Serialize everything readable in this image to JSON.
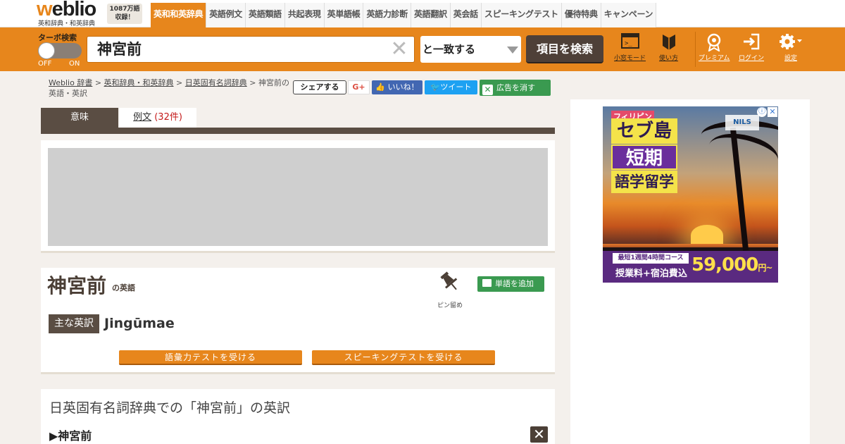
{
  "header": {
    "logo": "weblio",
    "logo_sub": "英和辞典・和英辞典",
    "count_line1": "1087万語",
    "count_line2": "収録！",
    "nav_tabs": [
      {
        "label": "英和和英辞典",
        "active": true
      },
      {
        "label": "英語例文"
      },
      {
        "label": "英語類語"
      },
      {
        "label": "共起表現"
      },
      {
        "label": "英単語帳"
      },
      {
        "label": "英語力診断"
      },
      {
        "label": "英語翻訳"
      },
      {
        "label": "英会話"
      },
      {
        "label": "スピーキングテスト"
      },
      {
        "label": "優待特典"
      },
      {
        "label": "キャンペーン"
      }
    ]
  },
  "search": {
    "turbo_label": "ターボ検索",
    "toggle_off": "OFF",
    "toggle_on": "ON",
    "query": "神宮前",
    "match_mode": "と一致する",
    "submit_label": "項目を検索",
    "icons": [
      {
        "name": "small-window-mode-icon",
        "label": "小窓モード"
      },
      {
        "name": "beginner-guide-icon",
        "label": "使い方"
      },
      {
        "name": "premium-icon",
        "label": "プレミアム"
      },
      {
        "name": "login-icon",
        "label": "ログイン"
      },
      {
        "name": "settings-icon",
        "label": "設定"
      }
    ]
  },
  "breadcrumb": {
    "items": [
      "Weblio 辞書",
      "英和辞典・和英辞典",
      "日英固有名詞辞典"
    ],
    "current": "神宮前の英語・英訳",
    "separator": " > "
  },
  "social": {
    "share": "シェアする",
    "gplus": "G+",
    "like": "いいね！",
    "tweet": "ツイート",
    "hide_ads": "広告を消す"
  },
  "content_tabs": {
    "meaning": "意味",
    "examples": "例文",
    "examples_count": "(32件)"
  },
  "entry": {
    "headword": "神宮前",
    "headword_suffix": "の英語",
    "pin_label": "ピン留め",
    "add_word": "単語を追加",
    "main_trans_label": "主な英訳",
    "main_translation": "Jingūmae",
    "vocab_test": "語彙力テストを受ける",
    "speaking_test": "スピーキングテストを受ける"
  },
  "dictionary": {
    "title": "日英固有名詞辞典での「神宮前」の英訳",
    "entry": "▶神宮前"
  },
  "side_ad": {
    "tag": "フィリピン",
    "line1": "セブ島",
    "line2": "短期",
    "line3": "語学留学",
    "brand": "NILS",
    "strip_line1": "最短1週間4時間コース",
    "strip_line2": "授業料+宿泊費込",
    "price": "59,000",
    "price_suffix": "円~"
  },
  "colors": {
    "brand_orange": "#e7861c",
    "dark_brown": "#5a4d43",
    "green_button": "#3a9a50",
    "background": "#f4f0ec"
  }
}
